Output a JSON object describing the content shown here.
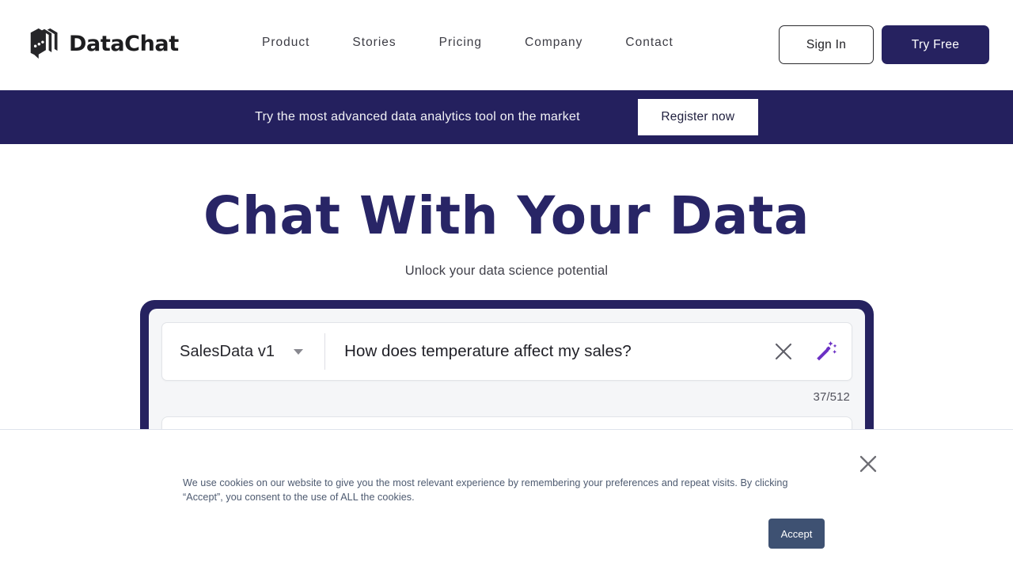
{
  "header": {
    "logo": {
      "text": "DataChat",
      "icon": "datachat-stacked-chat-logo"
    },
    "nav": [
      {
        "label": "Product"
      },
      {
        "label": "Stories"
      },
      {
        "label": "Pricing"
      },
      {
        "label": "Company"
      },
      {
        "label": "Contact"
      }
    ],
    "sign_in_label": "Sign In",
    "try_free_label": "Try Free"
  },
  "promo_banner": {
    "text": "Try the most advanced data analytics tool on the market",
    "button_label": "Register now",
    "background_color": "#24205e",
    "text_color": "#f2f2f6"
  },
  "hero": {
    "title": "Chat With Your Data",
    "subtitle": "Unlock your data science potential",
    "title_color": "#282566"
  },
  "app_mockup": {
    "frame_color": "#262260",
    "dataset": {
      "selected": "SalesData v1",
      "caret_icon": "chevron-down-icon"
    },
    "query": {
      "value": "How does temperature affect my sales?",
      "clear_icon": "close-x-icon",
      "magic_icon": "magic-wand-icon",
      "magic_icon_color": "#6b30c4"
    },
    "char_counter": "37/512"
  },
  "cookie_banner": {
    "text": "We use cookies on our website to give you the most relevant experience by remembering your preferences and repeat visits. By clicking “Accept”, you consent to the use of ALL the cookies.",
    "accept_label": "Accept",
    "accept_color": "#3e5172",
    "close_icon": "close-x-icon"
  }
}
